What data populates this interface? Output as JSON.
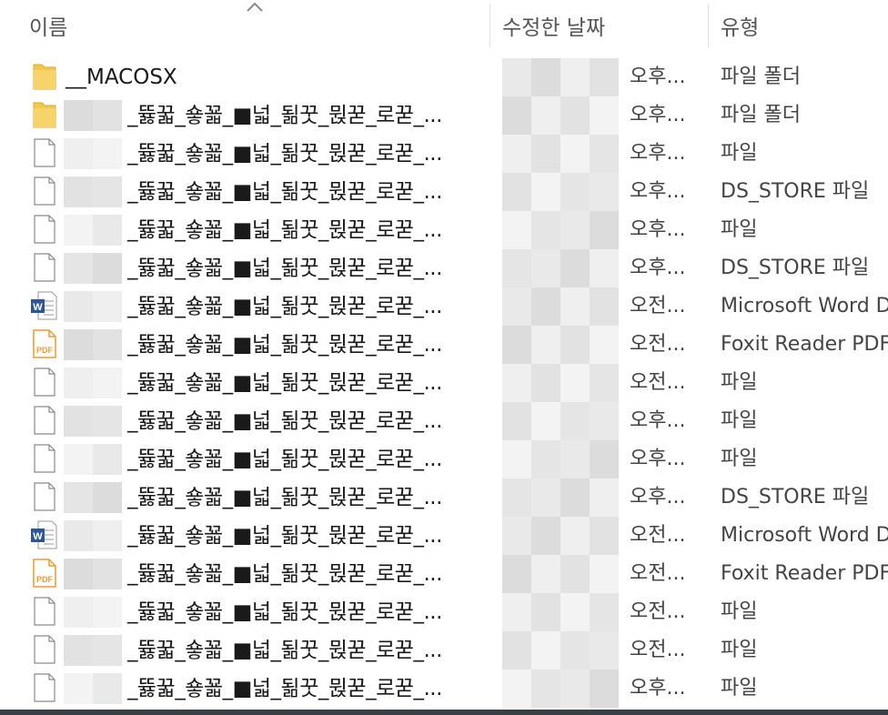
{
  "columns": {
    "name": "이름",
    "date": "수정한 날짜",
    "type": "유형"
  },
  "files": [
    {
      "icon": "folder-icon",
      "name": "__MACOSX",
      "date": "오후...",
      "type": "파일 폴더"
    },
    {
      "icon": "folder-icon",
      "name": "_뜛꿃_숗꾧_■넓_됢꿋_뮍꾿_로꾿_...",
      "date": "오후...",
      "type": "파일 폴더"
    },
    {
      "icon": "file-icon",
      "name": "_뜛꿃_숗꾧_■넓_됢꿋_뮍꾿_로꾿_...",
      "date": "오후...",
      "type": "파일"
    },
    {
      "icon": "file-icon",
      "name": "_뜛꿃_숗꾧_■넓_됢꿋_뮍꾿_로꾿_...",
      "date": "오후...",
      "type": "DS_STORE 파일"
    },
    {
      "icon": "file-icon",
      "name": "_뜛꿃_숗꾧_■넓_됢꿋_뮍꾿_로꾿_...",
      "date": "오후...",
      "type": "파일"
    },
    {
      "icon": "file-icon",
      "name": "_뜛꿃_숗꾧_■넓_됢꿋_뮍꾿_로꾿_...",
      "date": "오후...",
      "type": "DS_STORE 파일"
    },
    {
      "icon": "word-doc-icon",
      "name": "_뜛꿃_숗꾧_■넓_됢꿋_뮍꾿_로꾿_...",
      "date": "오전...",
      "type": "Microsoft Word D"
    },
    {
      "icon": "pdf-icon",
      "name": "_뜛꿃_숗꾧_■넓_됢꿋_뮍꾿_로꾿_...",
      "date": "오전...",
      "type": "Foxit Reader PDF"
    },
    {
      "icon": "file-icon",
      "name": "_뜛꿃_숗꾧_■넓_됢꿋_뮍꾿_로꾿_...",
      "date": "오전...",
      "type": "파일"
    },
    {
      "icon": "file-icon",
      "name": "_뜛꿃_숗꾧_■넓_됢꿋_뮍꾿_로꾿_...",
      "date": "오후...",
      "type": "파일"
    },
    {
      "icon": "file-icon",
      "name": "_뜛꿃_숗꾧_■넓_됢꿋_뮍꾿_로꾿_...",
      "date": "오후...",
      "type": "파일"
    },
    {
      "icon": "file-icon",
      "name": "_뜛꿃_숗꾧_■넓_됢꿋_뮍꾿_로꾿_...",
      "date": "오후...",
      "type": "DS_STORE 파일"
    },
    {
      "icon": "word-doc-icon",
      "name": "_뜛꿃_숗꾧_■넓_됢꿋_뮍꾿_로꾿_...",
      "date": "오전...",
      "type": "Microsoft Word D"
    },
    {
      "icon": "pdf-icon",
      "name": "_뜛꿃_숗꾧_■넓_됢꿋_뮍꾿_로꾿_...",
      "date": "오전...",
      "type": "Foxit Reader PDF"
    },
    {
      "icon": "file-icon",
      "name": "_뜛꿃_숗꾧_■넓_됢꿋_뮍꾿_로꾿_...",
      "date": "오전...",
      "type": "파일"
    },
    {
      "icon": "file-icon",
      "name": "_뜛꿃_숗꾧_■넓_됢꿋_뮍꾿_로꾿_...",
      "date": "오전...",
      "type": "파일"
    },
    {
      "icon": "file-icon",
      "name": "_뜛꿃_숗꾧_■넓_됢꿋_뮍꾿_로꾿_...",
      "date": "오후...",
      "type": "파일"
    }
  ],
  "colors": {
    "folder": "#f3c74a",
    "word": "#2b5797",
    "pdf": "#f29a2e",
    "redacted": "#e6e6e6"
  }
}
